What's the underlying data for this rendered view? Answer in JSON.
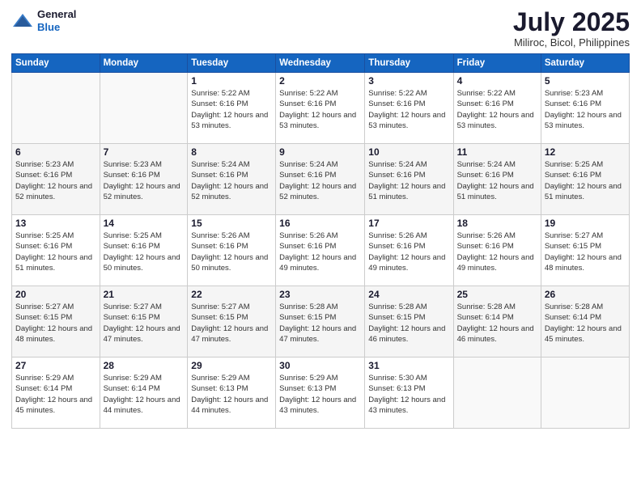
{
  "logo": {
    "general": "General",
    "blue": "Blue"
  },
  "header": {
    "month": "July 2025",
    "location": "Miliroc, Bicol, Philippines"
  },
  "weekdays": [
    "Sunday",
    "Monday",
    "Tuesday",
    "Wednesday",
    "Thursday",
    "Friday",
    "Saturday"
  ],
  "weeks": [
    [
      {
        "day": "",
        "sunrise": "",
        "sunset": "",
        "daylight": ""
      },
      {
        "day": "",
        "sunrise": "",
        "sunset": "",
        "daylight": ""
      },
      {
        "day": "1",
        "sunrise": "Sunrise: 5:22 AM",
        "sunset": "Sunset: 6:16 PM",
        "daylight": "Daylight: 12 hours and 53 minutes."
      },
      {
        "day": "2",
        "sunrise": "Sunrise: 5:22 AM",
        "sunset": "Sunset: 6:16 PM",
        "daylight": "Daylight: 12 hours and 53 minutes."
      },
      {
        "day": "3",
        "sunrise": "Sunrise: 5:22 AM",
        "sunset": "Sunset: 6:16 PM",
        "daylight": "Daylight: 12 hours and 53 minutes."
      },
      {
        "day": "4",
        "sunrise": "Sunrise: 5:22 AM",
        "sunset": "Sunset: 6:16 PM",
        "daylight": "Daylight: 12 hours and 53 minutes."
      },
      {
        "day": "5",
        "sunrise": "Sunrise: 5:23 AM",
        "sunset": "Sunset: 6:16 PM",
        "daylight": "Daylight: 12 hours and 53 minutes."
      }
    ],
    [
      {
        "day": "6",
        "sunrise": "Sunrise: 5:23 AM",
        "sunset": "Sunset: 6:16 PM",
        "daylight": "Daylight: 12 hours and 52 minutes."
      },
      {
        "day": "7",
        "sunrise": "Sunrise: 5:23 AM",
        "sunset": "Sunset: 6:16 PM",
        "daylight": "Daylight: 12 hours and 52 minutes."
      },
      {
        "day": "8",
        "sunrise": "Sunrise: 5:24 AM",
        "sunset": "Sunset: 6:16 PM",
        "daylight": "Daylight: 12 hours and 52 minutes."
      },
      {
        "day": "9",
        "sunrise": "Sunrise: 5:24 AM",
        "sunset": "Sunset: 6:16 PM",
        "daylight": "Daylight: 12 hours and 52 minutes."
      },
      {
        "day": "10",
        "sunrise": "Sunrise: 5:24 AM",
        "sunset": "Sunset: 6:16 PM",
        "daylight": "Daylight: 12 hours and 51 minutes."
      },
      {
        "day": "11",
        "sunrise": "Sunrise: 5:24 AM",
        "sunset": "Sunset: 6:16 PM",
        "daylight": "Daylight: 12 hours and 51 minutes."
      },
      {
        "day": "12",
        "sunrise": "Sunrise: 5:25 AM",
        "sunset": "Sunset: 6:16 PM",
        "daylight": "Daylight: 12 hours and 51 minutes."
      }
    ],
    [
      {
        "day": "13",
        "sunrise": "Sunrise: 5:25 AM",
        "sunset": "Sunset: 6:16 PM",
        "daylight": "Daylight: 12 hours and 51 minutes."
      },
      {
        "day": "14",
        "sunrise": "Sunrise: 5:25 AM",
        "sunset": "Sunset: 6:16 PM",
        "daylight": "Daylight: 12 hours and 50 minutes."
      },
      {
        "day": "15",
        "sunrise": "Sunrise: 5:26 AM",
        "sunset": "Sunset: 6:16 PM",
        "daylight": "Daylight: 12 hours and 50 minutes."
      },
      {
        "day": "16",
        "sunrise": "Sunrise: 5:26 AM",
        "sunset": "Sunset: 6:16 PM",
        "daylight": "Daylight: 12 hours and 49 minutes."
      },
      {
        "day": "17",
        "sunrise": "Sunrise: 5:26 AM",
        "sunset": "Sunset: 6:16 PM",
        "daylight": "Daylight: 12 hours and 49 minutes."
      },
      {
        "day": "18",
        "sunrise": "Sunrise: 5:26 AM",
        "sunset": "Sunset: 6:16 PM",
        "daylight": "Daylight: 12 hours and 49 minutes."
      },
      {
        "day": "19",
        "sunrise": "Sunrise: 5:27 AM",
        "sunset": "Sunset: 6:15 PM",
        "daylight": "Daylight: 12 hours and 48 minutes."
      }
    ],
    [
      {
        "day": "20",
        "sunrise": "Sunrise: 5:27 AM",
        "sunset": "Sunset: 6:15 PM",
        "daylight": "Daylight: 12 hours and 48 minutes."
      },
      {
        "day": "21",
        "sunrise": "Sunrise: 5:27 AM",
        "sunset": "Sunset: 6:15 PM",
        "daylight": "Daylight: 12 hours and 47 minutes."
      },
      {
        "day": "22",
        "sunrise": "Sunrise: 5:27 AM",
        "sunset": "Sunset: 6:15 PM",
        "daylight": "Daylight: 12 hours and 47 minutes."
      },
      {
        "day": "23",
        "sunrise": "Sunrise: 5:28 AM",
        "sunset": "Sunset: 6:15 PM",
        "daylight": "Daylight: 12 hours and 47 minutes."
      },
      {
        "day": "24",
        "sunrise": "Sunrise: 5:28 AM",
        "sunset": "Sunset: 6:15 PM",
        "daylight": "Daylight: 12 hours and 46 minutes."
      },
      {
        "day": "25",
        "sunrise": "Sunrise: 5:28 AM",
        "sunset": "Sunset: 6:14 PM",
        "daylight": "Daylight: 12 hours and 46 minutes."
      },
      {
        "day": "26",
        "sunrise": "Sunrise: 5:28 AM",
        "sunset": "Sunset: 6:14 PM",
        "daylight": "Daylight: 12 hours and 45 minutes."
      }
    ],
    [
      {
        "day": "27",
        "sunrise": "Sunrise: 5:29 AM",
        "sunset": "Sunset: 6:14 PM",
        "daylight": "Daylight: 12 hours and 45 minutes."
      },
      {
        "day": "28",
        "sunrise": "Sunrise: 5:29 AM",
        "sunset": "Sunset: 6:14 PM",
        "daylight": "Daylight: 12 hours and 44 minutes."
      },
      {
        "day": "29",
        "sunrise": "Sunrise: 5:29 AM",
        "sunset": "Sunset: 6:13 PM",
        "daylight": "Daylight: 12 hours and 44 minutes."
      },
      {
        "day": "30",
        "sunrise": "Sunrise: 5:29 AM",
        "sunset": "Sunset: 6:13 PM",
        "daylight": "Daylight: 12 hours and 43 minutes."
      },
      {
        "day": "31",
        "sunrise": "Sunrise: 5:30 AM",
        "sunset": "Sunset: 6:13 PM",
        "daylight": "Daylight: 12 hours and 43 minutes."
      },
      {
        "day": "",
        "sunrise": "",
        "sunset": "",
        "daylight": ""
      },
      {
        "day": "",
        "sunrise": "",
        "sunset": "",
        "daylight": ""
      }
    ]
  ]
}
